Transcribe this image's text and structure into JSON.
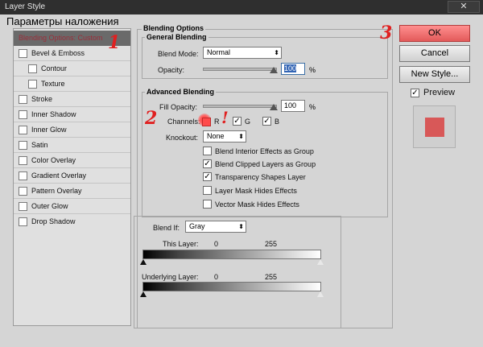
{
  "window": {
    "title": "Layer Style",
    "close_label": "✕"
  },
  "overlay_title": "Параметры наложения",
  "annotations": {
    "one": "1",
    "two": "2",
    "three": "3",
    "exclaim": "!"
  },
  "styles_list": [
    {
      "label": "Blending Options: Custom",
      "checkbox": false,
      "indent": 0,
      "selected": true
    },
    {
      "label": "Bevel & Emboss",
      "checkbox": true,
      "indent": 0
    },
    {
      "label": "Contour",
      "checkbox": true,
      "indent": 1
    },
    {
      "label": "Texture",
      "checkbox": true,
      "indent": 1
    },
    {
      "label": "Stroke",
      "checkbox": true,
      "indent": 0
    },
    {
      "label": "Inner Shadow",
      "checkbox": true,
      "indent": 0
    },
    {
      "label": "Inner Glow",
      "checkbox": true,
      "indent": 0
    },
    {
      "label": "Satin",
      "checkbox": true,
      "indent": 0
    },
    {
      "label": "Color Overlay",
      "checkbox": true,
      "indent": 0
    },
    {
      "label": "Gradient Overlay",
      "checkbox": true,
      "indent": 0
    },
    {
      "label": "Pattern Overlay",
      "checkbox": true,
      "indent": 0
    },
    {
      "label": "Outer Glow",
      "checkbox": true,
      "indent": 0
    },
    {
      "label": "Drop Shadow",
      "checkbox": true,
      "indent": 0
    }
  ],
  "blending_options": {
    "title": "Blending Options",
    "general": {
      "title": "General Blending",
      "blend_mode_label": "Blend Mode:",
      "blend_mode_value": "Normal",
      "opacity_label": "Opacity:",
      "opacity_value": "100",
      "pct": "%"
    },
    "advanced": {
      "title": "Advanced Blending",
      "fill_opacity_label": "Fill Opacity:",
      "fill_opacity_value": "100",
      "pct": "%",
      "channels_label": "Channels:",
      "channel_r": "R",
      "channel_g": "G",
      "channel_b": "B",
      "knockout_label": "Knockout:",
      "knockout_value": "None",
      "options": [
        {
          "label": "Blend Interior Effects as Group",
          "checked": false
        },
        {
          "label": "Blend Clipped Layers as Group",
          "checked": true
        },
        {
          "label": "Transparency Shapes Layer",
          "checked": true
        },
        {
          "label": "Layer Mask Hides Effects",
          "checked": false
        },
        {
          "label": "Vector Mask Hides Effects",
          "checked": false
        }
      ]
    },
    "blend_if": {
      "label": "Blend If:",
      "value": "Gray",
      "this_layer_label": "This Layer:",
      "this_layer_min": "0",
      "this_layer_max": "255",
      "underlying_label": "Underlying Layer:",
      "underlying_min": "0",
      "underlying_max": "255"
    }
  },
  "buttons": {
    "ok": "OK",
    "cancel": "Cancel",
    "new_style": "New Style...",
    "preview_label": "Preview"
  },
  "colors": {
    "ok_button": "#e35a5a",
    "preview_swatch": "#d85858",
    "annotation": "#e02020"
  }
}
